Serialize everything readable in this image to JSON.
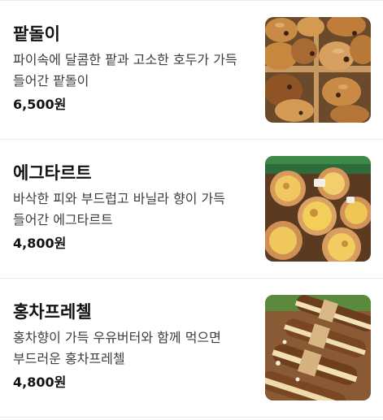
{
  "menu": {
    "items": [
      {
        "name": "팥돌이",
        "description": "파이속에 달콤한 팥과 고소한 호두가 가득 들어간 팥돌이",
        "price": "6,500원",
        "image_icon": "bread-photo-icon"
      },
      {
        "name": "에그타르트",
        "description": "바삭한 피와 부드럽고 바닐라 향이 가득 들어간 에그타르트",
        "price": "4,800원",
        "image_icon": "egg-tart-photo-icon"
      },
      {
        "name": "홍차프레첼",
        "description": "홍차향이 가득 우유버터와 함께 먹으면 부드러운 홍차프레첼",
        "price": "4,800원",
        "image_icon": "pretzel-photo-icon"
      }
    ]
  }
}
